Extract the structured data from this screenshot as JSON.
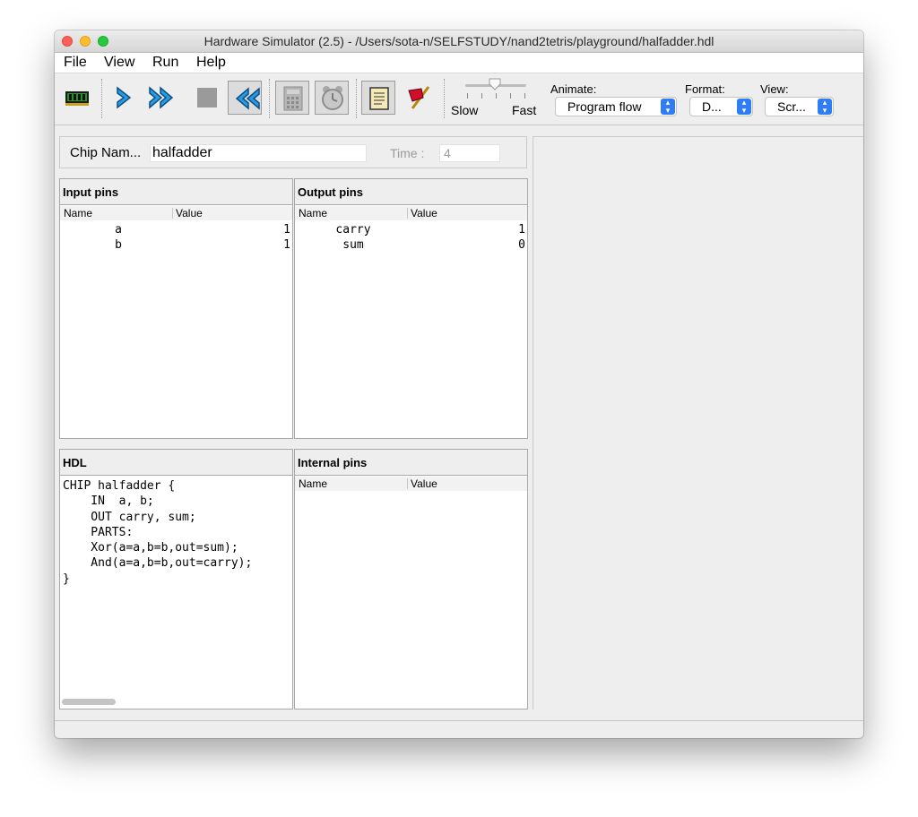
{
  "window": {
    "title": "Hardware Simulator (2.5) - /Users/sota-n/SELFSTUDY/nand2tetris/playground/halfadder.hdl"
  },
  "menu": [
    "File",
    "View",
    "Run",
    "Help"
  ],
  "toolbar": {
    "buttons": [
      "load-chip",
      "single-step",
      "run",
      "stop",
      "reset",
      "eval",
      "tick-tock",
      "script",
      "breakpoints"
    ],
    "speed": {
      "slow_label": "Slow",
      "fast_label": "Fast"
    },
    "animate": {
      "label": "Animate:",
      "value": "Program flow"
    },
    "format": {
      "label": "Format:",
      "value": "D..."
    },
    "view": {
      "label": "View:",
      "value": "Scr..."
    }
  },
  "chip": {
    "label": "Chip Nam...",
    "name": "halfadder",
    "time_label": "Time :",
    "time_value": "4"
  },
  "input_pins": {
    "title": "Input pins",
    "columns": [
      "Name",
      "Value"
    ],
    "rows": [
      {
        "name": "a",
        "value": "1"
      },
      {
        "name": "b",
        "value": "1"
      }
    ]
  },
  "output_pins": {
    "title": "Output pins",
    "columns": [
      "Name",
      "Value"
    ],
    "rows": [
      {
        "name": "carry",
        "value": "1"
      },
      {
        "name": "sum",
        "value": "0"
      }
    ]
  },
  "hdl": {
    "title": "HDL",
    "code": "CHIP halfadder {\n    IN  a, b;\n    OUT carry, sum;\n    PARTS:\n    Xor(a=a,b=b,out=sum);\n    And(a=a,b=b,out=carry);\n}"
  },
  "internal_pins": {
    "title": "Internal pins",
    "columns": [
      "Name",
      "Value"
    ]
  },
  "colors": {
    "accent": "#2e7cf6",
    "arrow_blue": "#2b9be0"
  }
}
